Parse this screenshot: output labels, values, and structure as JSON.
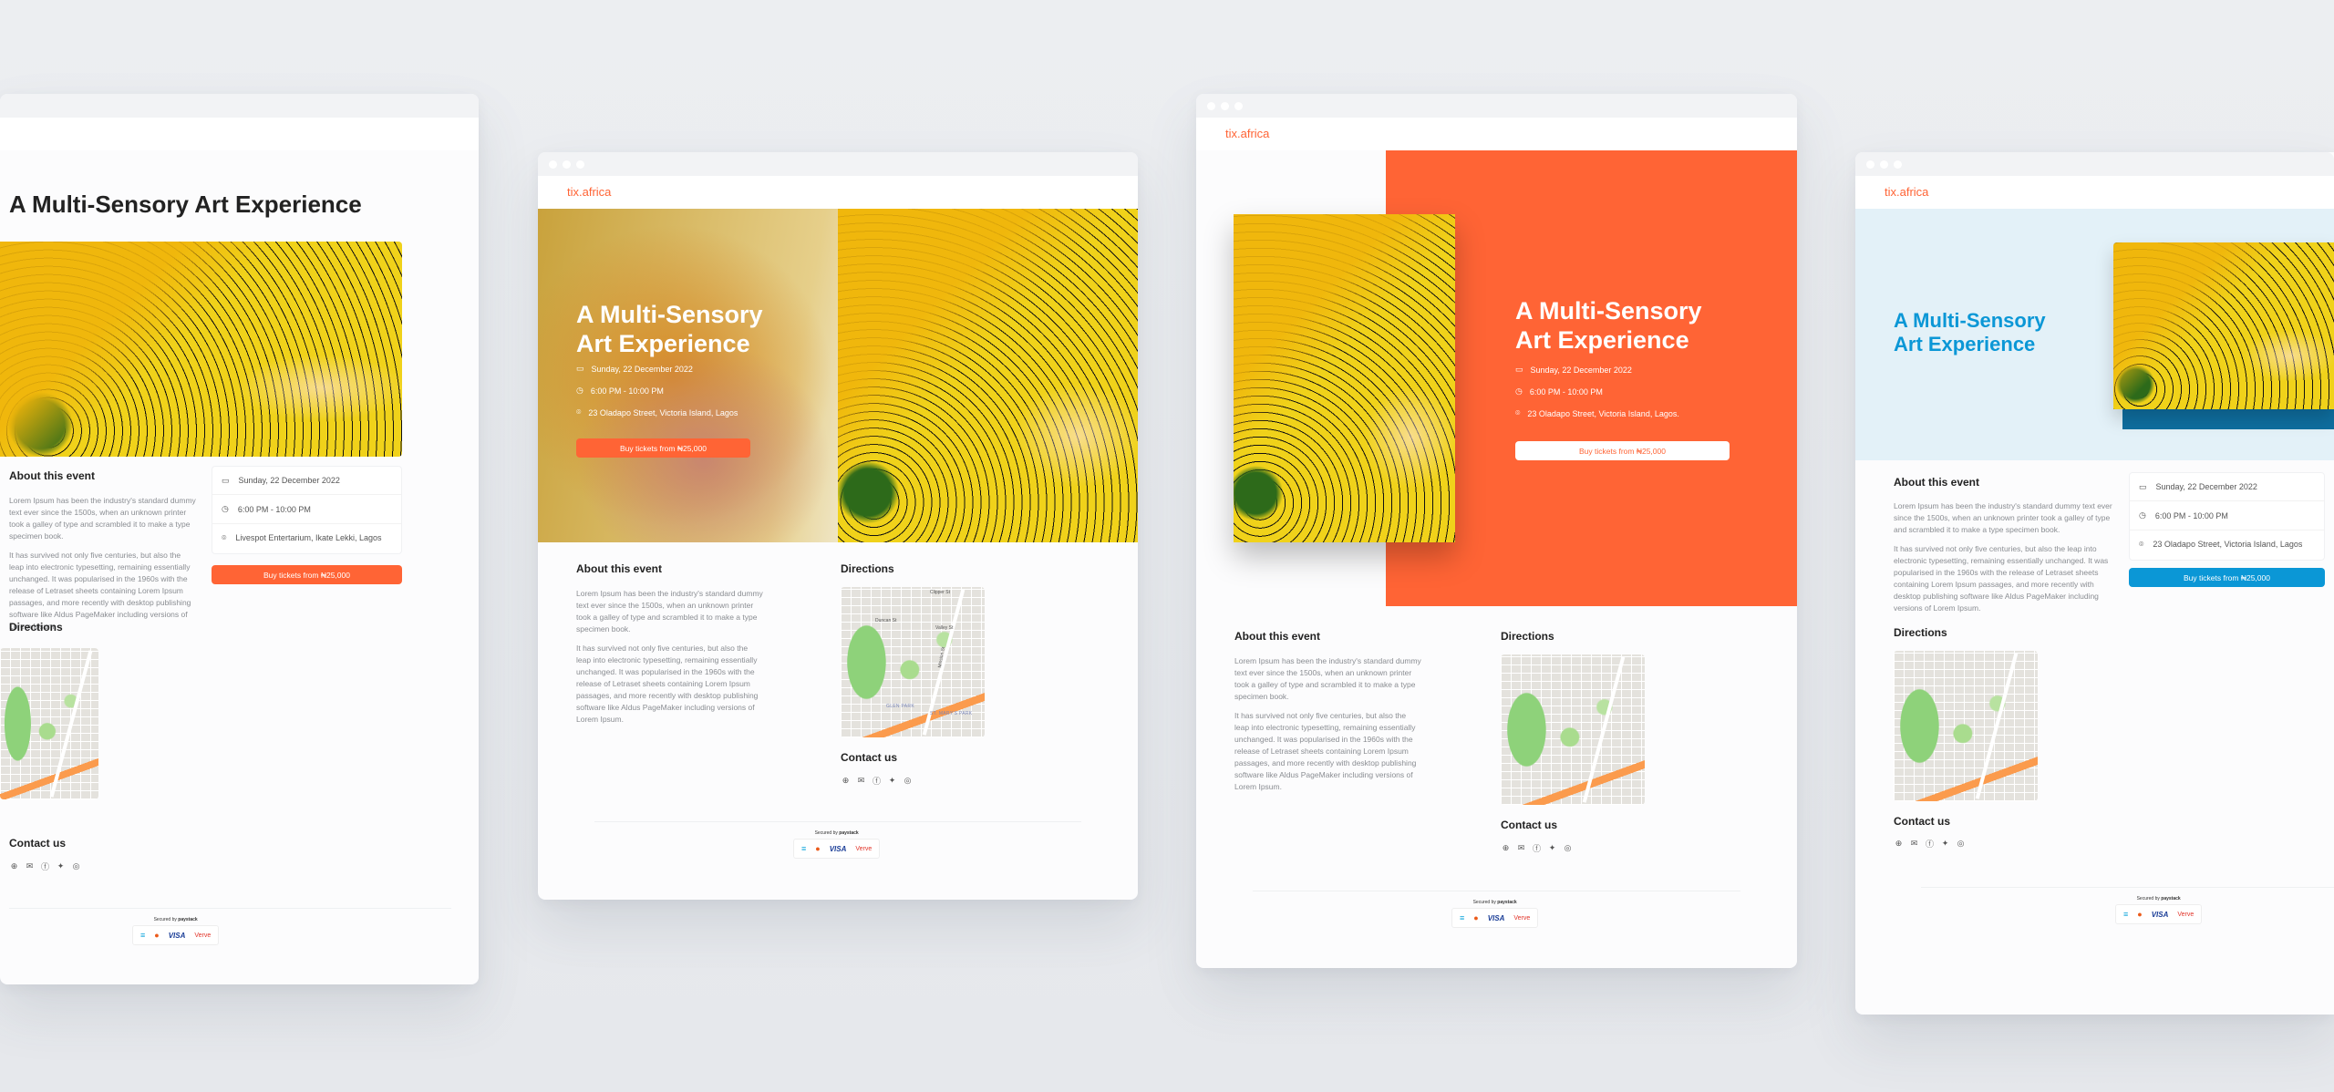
{
  "brand": "tix.africa",
  "event": {
    "title": "A Multi-Sensory Art Experience",
    "title_line1": "A Multi-Sensory",
    "title_line2": "Art Experience",
    "date": "Sunday, 22 December 2022",
    "time": "6:00 PM - 10:00 PM",
    "venue_a": "Livespot Entertarium, Ikate Lekki, Lagos",
    "venue_b": "23 Oladapo Street, Victoria Island, Lagos",
    "venue_c": "23 Oladapo Street, Victoria Island, Lagos.",
    "buy_label": "Buy tickets from ₦25,000"
  },
  "about": {
    "heading": "About this event",
    "p1": "Lorem Ipsum has been the industry's standard dummy text ever since the 1500s, when an unknown printer took a galley of type and scrambled it to make a type specimen book.",
    "p2": "It has survived not only five centuries, but also the leap into electronic typesetting, remaining essentially unchanged. It was popularised in the 1960s with the release of Letraset sheets containing Lorem Ipsum passages, and more recently with desktop publishing software like Aldus PageMaker including versions of Lorem Ipsum."
  },
  "directions": {
    "heading": "Directions",
    "labels": [
      "Clipper St",
      "Duncan St",
      "Valley St",
      "GLEN PARK",
      "ST. MARY'S PARK",
      "Mission St"
    ]
  },
  "contact": {
    "heading": "Contact us",
    "icons": [
      "globe-icon",
      "mail-icon",
      "facebook-icon",
      "twitter-icon",
      "instagram-icon"
    ]
  },
  "footer": {
    "secured_prefix": "Secured by",
    "secured_brand": "paystack",
    "payments": [
      "paystack",
      "mastercard",
      "VISA",
      "Verve"
    ]
  },
  "colors": {
    "accent_orange": "#ff6435",
    "accent_blue": "#0b97d6",
    "hero_blue_bg": "#e3f1f8"
  }
}
